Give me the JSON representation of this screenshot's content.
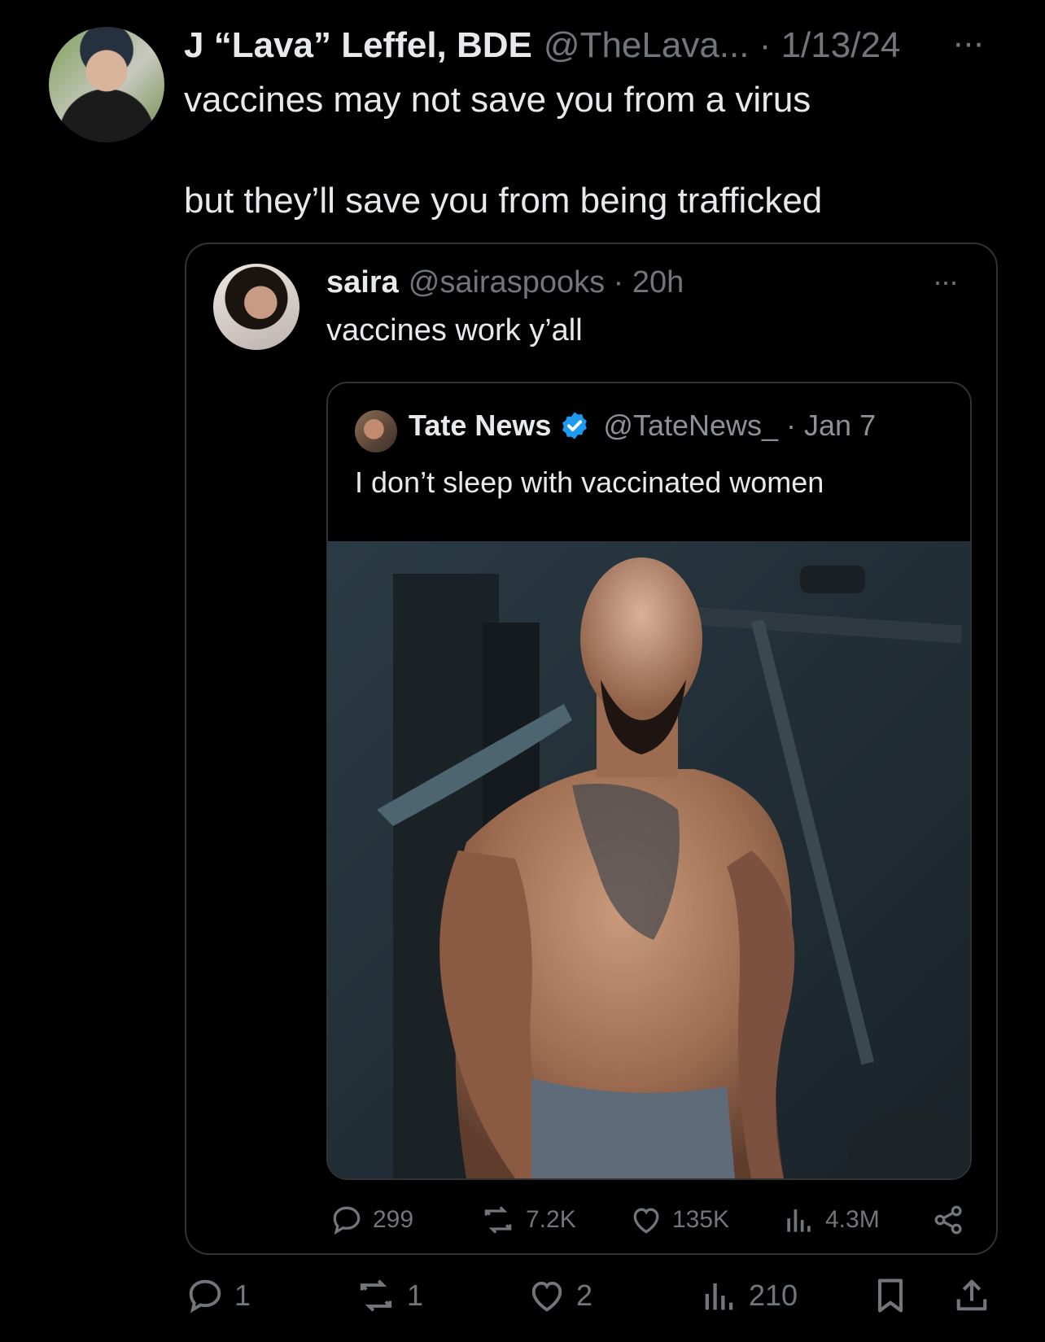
{
  "tweet": {
    "author_name": "J “Lava” Leffel, BDE",
    "handle_date": "@TheLava... · 1/13/24",
    "more": "···",
    "text_line1": "vaccines may not save you from a virus",
    "text_line2": "but they’ll save you from being trafficked",
    "actions": {
      "replies": "1",
      "reposts": "1",
      "likes": "2",
      "views": "210"
    }
  },
  "quote": {
    "author_name": "saira",
    "handle_time": "@sairaspooks · 20h",
    "more": "···",
    "text": "vaccines work y’all",
    "stats": {
      "replies": "299",
      "reposts": "7.2K",
      "likes": "135K",
      "views": "4.3M"
    },
    "inner": {
      "author_name": "Tate News",
      "handle_date": "@TateNews_ · Jan 7",
      "text": "I don’t sleep with vaccinated women"
    }
  },
  "colors": {
    "background": "#000000",
    "text": "#e7e9ea",
    "muted": "#71767b",
    "border": "#2f3336",
    "verified": "#1d9bf0"
  }
}
